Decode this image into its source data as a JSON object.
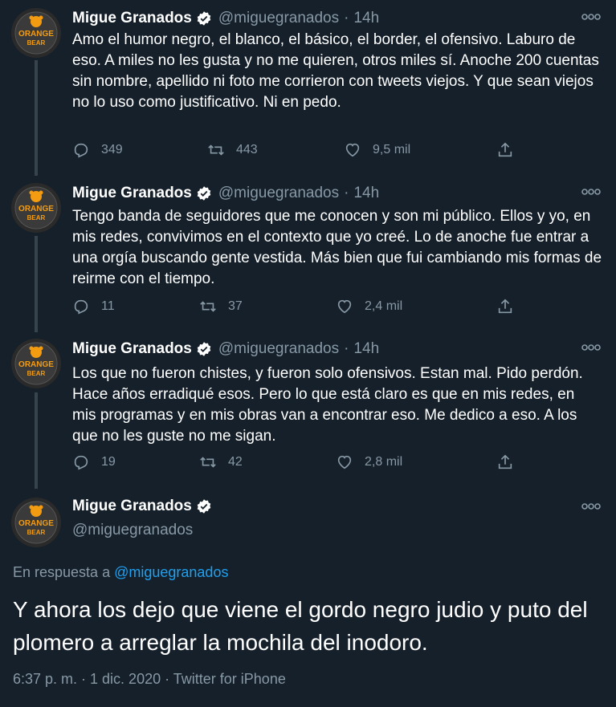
{
  "avatar_text": [
    "ORANGE",
    "BEAR"
  ],
  "colors": {
    "background": "#15202b",
    "secondary_text": "#8899a6",
    "link": "#1da1f2",
    "verified": "#ffffff",
    "avatar_orange": "#f39c12"
  },
  "tweets": [
    {
      "name": "Migue Granados",
      "handle": "@miguegranados",
      "dot": "·",
      "time": "14h",
      "text": "Amo el humor negro, el blanco, el básico, el border, el ofensivo. Laburo de eso. A miles no les gusta y no me quieren, otros miles sí. Anoche 200 cuentas sin nombre, apellido ni foto me corrieron con tweets viejos. Y que sean viejos no lo uso como justificativo. Ni en pedo.",
      "replies": "349",
      "retweets": "443",
      "likes": "9,5 mil"
    },
    {
      "name": "Migue Granados",
      "handle": "@miguegranados",
      "dot": "·",
      "time": "14h",
      "text": "Tengo banda de seguidores que me conocen y son mi público. Ellos y yo, en mis redes, convivimos en el contexto que yo creé. Lo de anoche fue entrar a una orgía buscando gente vestida. Más bien que fui cambiando mis formas de reirme con el tiempo.",
      "replies": "11",
      "retweets": "37",
      "likes": "2,4 mil"
    },
    {
      "name": "Migue Granados",
      "handle": "@miguegranados",
      "dot": "·",
      "time": "14h",
      "text": "Los que no fueron chistes, y fueron solo ofensivos. Estan mal. Pido perdón. Hace años erradiqué esos. Pero lo que está claro es que en mis redes, en mis programas y en mis obras van a encontrar eso. Me dedico a eso. A los que no les guste no me sigan.",
      "replies": "19",
      "retweets": "42",
      "likes": "2,8 mil"
    }
  ],
  "final": {
    "name": "Migue Granados",
    "handle": "@miguegranados",
    "reply_prefix": "En respuesta a",
    "reply_mention": "@miguegranados",
    "text": "Y ahora los dejo que viene el gordo negro judio y puto del plomero a arreglar la mochila del inodoro.",
    "meta": "6:37 p. m. · 1 dic. 2020 · Twitter for iPhone"
  }
}
